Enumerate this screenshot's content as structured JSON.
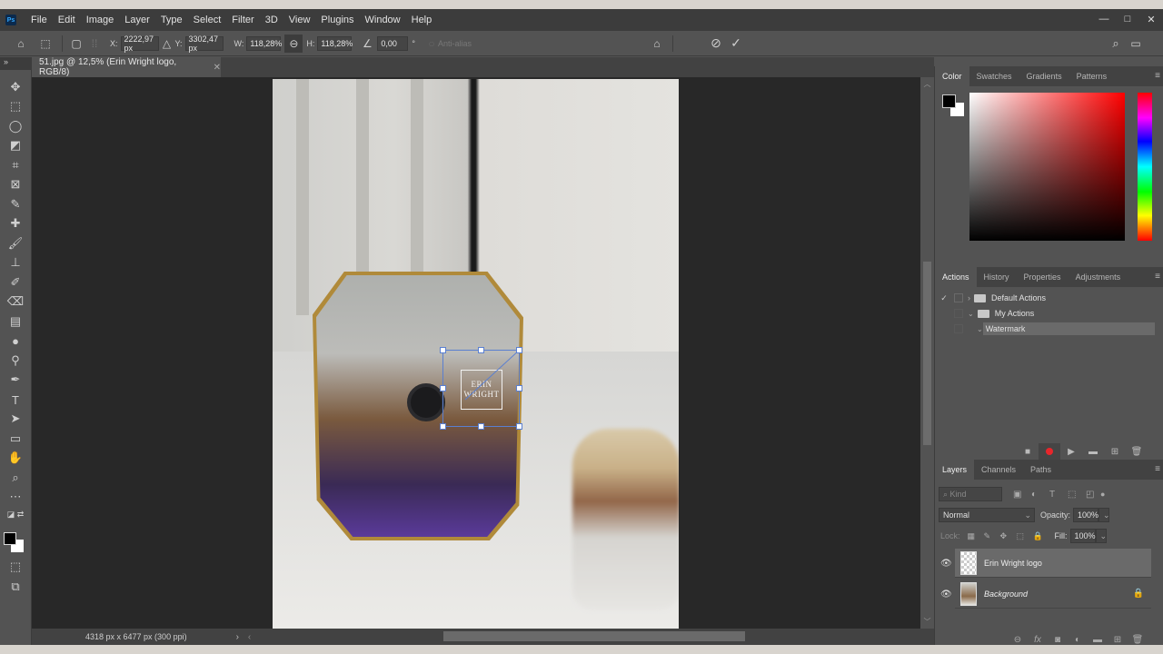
{
  "app": {
    "logo": "Ps"
  },
  "menu": [
    "File",
    "Edit",
    "Image",
    "Layer",
    "Type",
    "Select",
    "Filter",
    "3D",
    "View",
    "Plugins",
    "Window",
    "Help"
  ],
  "window_controls": {
    "minimize": "—",
    "maximize": "□",
    "close": "✕"
  },
  "options": {
    "x_label": "X:",
    "x_value": "2222,97 px",
    "y_label": "Y:",
    "y_value": "3302,47 px",
    "w_label": "W:",
    "w_value": "118,28%",
    "h_label": "H:",
    "h_value": "118,28%",
    "angle_value": "0,00",
    "angle_unit": "°",
    "antialias_label": "Anti-alias"
  },
  "document": {
    "tab_title": "51.jpg @ 12,5% (Erin Wright logo, RGB/8)",
    "status": "4318 px x 6477 px (300 ppi)",
    "logo_line1": "ERIN",
    "logo_line2": "WRIGHT"
  },
  "color_panel": {
    "tabs": [
      "Color",
      "Swatches",
      "Gradients",
      "Patterns"
    ],
    "foreground": "#000000",
    "background": "#ffffff",
    "hue": "#ff0000"
  },
  "actions_panel": {
    "tabs": [
      "Actions",
      "History",
      "Properties",
      "Adjustments"
    ],
    "items": [
      {
        "label": "Default Actions",
        "type": "set",
        "expanded": false,
        "checked": true
      },
      {
        "label": "My Actions",
        "type": "set",
        "expanded": true,
        "checked": false
      },
      {
        "label": "Watermark",
        "type": "action",
        "expanded": true,
        "checked": false,
        "selected": true
      }
    ]
  },
  "layers_panel": {
    "tabs": [
      "Layers",
      "Channels",
      "Paths"
    ],
    "filter_placeholder": "Kind",
    "blend_mode": "Normal",
    "opacity_label": "Opacity:",
    "opacity": "100%",
    "lock_label": "Lock:",
    "fill_label": "Fill:",
    "fill": "100%",
    "layers": [
      {
        "name": "Erin Wright logo",
        "visible": true,
        "selected": true,
        "locked": false
      },
      {
        "name": "Background",
        "visible": true,
        "selected": false,
        "locked": true
      }
    ]
  }
}
